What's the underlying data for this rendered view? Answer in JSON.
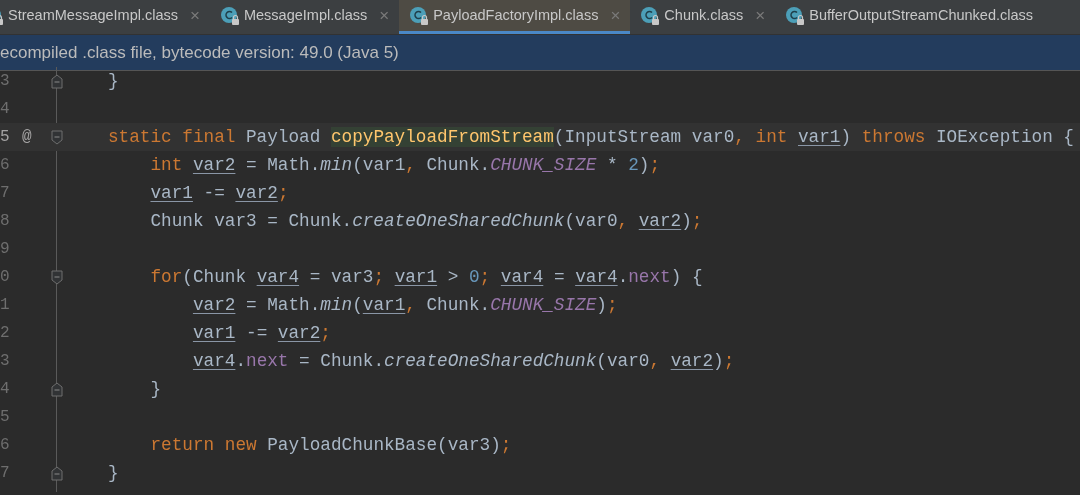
{
  "tabs": [
    {
      "label": "StreamMessageImpl.class",
      "selected": false,
      "closable": true
    },
    {
      "label": "MessageImpl.class",
      "selected": false,
      "closable": true
    },
    {
      "label": "PayloadFactoryImpl.class",
      "selected": true,
      "closable": true
    },
    {
      "label": "Chunk.class",
      "selected": false,
      "closable": true
    },
    {
      "label": "BufferOutputStreamChunked.class",
      "selected": false,
      "closable": false
    }
  ],
  "close_glyph": "×",
  "banner": {
    "text": "ecompiled .class file, bytecode version: 49.0 (Java 5)"
  },
  "editor": {
    "lines": [
      {
        "number": "3",
        "kind": "closer",
        "current": false,
        "tokens": [
          {
            "text": "}",
            "kind": "plain"
          }
        ]
      },
      {
        "number": "4",
        "kind": "plain",
        "current": false
      },
      {
        "number": "5",
        "marker": "@",
        "kind": "opener",
        "current": true,
        "tokens": [
          {
            "text": "static final ",
            "kind": "kw"
          },
          {
            "text": "Payload ",
            "kind": "plain"
          },
          {
            "text": "copyPayloadFromStream",
            "kind": "decl"
          },
          {
            "text": "(InputStream var0",
            "kind": "plain"
          },
          {
            "text": ", ",
            "kind": "kw"
          },
          {
            "text": "int ",
            "kind": "kw"
          },
          {
            "text": "var1",
            "kind": "var"
          },
          {
            "text": ") ",
            "kind": "plain"
          },
          {
            "text": "throws ",
            "kind": "kw"
          },
          {
            "text": "IOException {",
            "kind": "plain"
          }
        ]
      },
      {
        "number": "6",
        "kind": "plain",
        "current": false,
        "tokens": [
          {
            "text": "    int ",
            "kind": "kw"
          },
          {
            "text": "var2",
            "kind": "var"
          },
          {
            "text": " = Math.",
            "kind": "plain"
          },
          {
            "text": "min",
            "kind": "call"
          },
          {
            "text": "(var1",
            "kind": "plain"
          },
          {
            "text": ", ",
            "kind": "kw"
          },
          {
            "text": "Chunk.",
            "kind": "plain"
          },
          {
            "text": "CHUNK_SIZE",
            "kind": "const"
          },
          {
            "text": " * ",
            "kind": "plain"
          },
          {
            "text": "2",
            "kind": "num"
          },
          {
            "text": ")",
            "kind": "plain"
          },
          {
            "text": ";",
            "kind": "kw"
          }
        ]
      },
      {
        "number": "7",
        "kind": "plain",
        "current": false,
        "tokens": [
          {
            "text": "    var1",
            "kind": "var"
          },
          {
            "text": " -= ",
            "kind": "plain"
          },
          {
            "text": "var2",
            "kind": "var"
          },
          {
            "text": ";",
            "kind": "kw"
          }
        ]
      },
      {
        "number": "8",
        "kind": "plain",
        "current": false,
        "tokens": [
          {
            "text": "    Chunk var3 = Chunk.",
            "kind": "plain"
          },
          {
            "text": "createOneSharedChunk",
            "kind": "call"
          },
          {
            "text": "(var0",
            "kind": "plain"
          },
          {
            "text": ", ",
            "kind": "kw"
          },
          {
            "text": "var2",
            "kind": "var"
          },
          {
            "text": ")",
            "kind": "plain"
          },
          {
            "text": ";",
            "kind": "kw"
          }
        ]
      },
      {
        "number": "9",
        "kind": "plain",
        "current": false
      },
      {
        "number": "0",
        "kind": "opener",
        "current": false,
        "tokens": [
          {
            "text": "    for",
            "kind": "kw"
          },
          {
            "text": "(Chunk ",
            "kind": "plain"
          },
          {
            "text": "var4",
            "kind": "var"
          },
          {
            "text": " = var3",
            "kind": "plain"
          },
          {
            "text": "; ",
            "kind": "kw"
          },
          {
            "text": "var1",
            "kind": "var"
          },
          {
            "text": " > ",
            "kind": "plain"
          },
          {
            "text": "0",
            "kind": "num"
          },
          {
            "text": "; ",
            "kind": "kw"
          },
          {
            "text": "var4",
            "kind": "var"
          },
          {
            "text": " = ",
            "kind": "plain"
          },
          {
            "text": "var4",
            "kind": "var"
          },
          {
            "text": ".",
            "kind": "plain"
          },
          {
            "text": "next",
            "kind": "field"
          },
          {
            "text": ") {",
            "kind": "plain"
          }
        ]
      },
      {
        "number": "1",
        "kind": "plain",
        "current": false,
        "tokens": [
          {
            "text": "        var2",
            "kind": "var"
          },
          {
            "text": " = Math.",
            "kind": "plain"
          },
          {
            "text": "min",
            "kind": "call"
          },
          {
            "text": "(",
            "kind": "plain"
          },
          {
            "text": "var1",
            "kind": "var"
          },
          {
            "text": ", ",
            "kind": "kw"
          },
          {
            "text": "Chunk.",
            "kind": "plain"
          },
          {
            "text": "CHUNK_SIZE",
            "kind": "const"
          },
          {
            "text": ")",
            "kind": "plain"
          },
          {
            "text": ";",
            "kind": "kw"
          }
        ]
      },
      {
        "number": "2",
        "kind": "plain",
        "current": false,
        "tokens": [
          {
            "text": "        var1",
            "kind": "var"
          },
          {
            "text": " -= ",
            "kind": "plain"
          },
          {
            "text": "var2",
            "kind": "var"
          },
          {
            "text": ";",
            "kind": "kw"
          }
        ]
      },
      {
        "number": "3",
        "kind": "plain",
        "current": false,
        "tokens": [
          {
            "text": "        var4",
            "kind": "var"
          },
          {
            "text": ".",
            "kind": "plain"
          },
          {
            "text": "next",
            "kind": "field"
          },
          {
            "text": " = Chunk.",
            "kind": "plain"
          },
          {
            "text": "createOneSharedChunk",
            "kind": "call"
          },
          {
            "text": "(var0",
            "kind": "plain"
          },
          {
            "text": ", ",
            "kind": "kw"
          },
          {
            "text": "var2",
            "kind": "var"
          },
          {
            "text": ")",
            "kind": "plain"
          },
          {
            "text": ";",
            "kind": "kw"
          }
        ]
      },
      {
        "number": "4",
        "kind": "closer",
        "current": false,
        "tokens": [
          {
            "text": "    }",
            "kind": "plain"
          }
        ]
      },
      {
        "number": "5",
        "kind": "plain",
        "current": false
      },
      {
        "number": "6",
        "kind": "plain",
        "current": false,
        "tokens": [
          {
            "text": "    return new ",
            "kind": "kw"
          },
          {
            "text": "PayloadChunkBase(var3)",
            "kind": "plain"
          },
          {
            "text": ";",
            "kind": "kw"
          }
        ]
      },
      {
        "number": "7",
        "kind": "closer",
        "current": false,
        "tokens": [
          {
            "text": "}",
            "kind": "plain"
          }
        ]
      }
    ]
  }
}
